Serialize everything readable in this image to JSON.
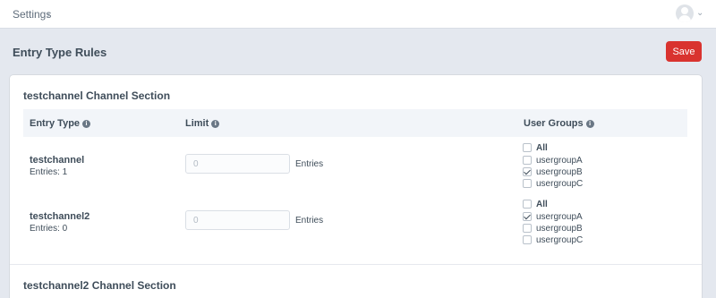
{
  "topbar": {
    "breadcrumb": "Settings",
    "separator": "›"
  },
  "page": {
    "title": "Entry Type Rules",
    "save_label": "Save"
  },
  "sections": [
    {
      "title": "testchannel Channel Section",
      "headers": {
        "entry_type": "Entry Type",
        "limit": "Limit",
        "user_groups": "User Groups"
      },
      "rows": [
        {
          "name": "testchannel",
          "entries": "Entries: 1",
          "limit_value": "0",
          "limit_unit": "Entries",
          "groups": [
            {
              "label": "All",
              "checked": false
            },
            {
              "label": "usergroupA",
              "checked": false
            },
            {
              "label": "usergroupB",
              "checked": true
            },
            {
              "label": "usergroupC",
              "checked": false
            }
          ]
        },
        {
          "name": "testchannel2",
          "entries": "Entries: 0",
          "limit_value": "0",
          "limit_unit": "Entries",
          "groups": [
            {
              "label": "All",
              "checked": false
            },
            {
              "label": "usergroupA",
              "checked": true
            },
            {
              "label": "usergroupB",
              "checked": false
            },
            {
              "label": "usergroupC",
              "checked": false
            }
          ]
        }
      ]
    },
    {
      "title": "testchannel2 Channel Section"
    }
  ]
}
